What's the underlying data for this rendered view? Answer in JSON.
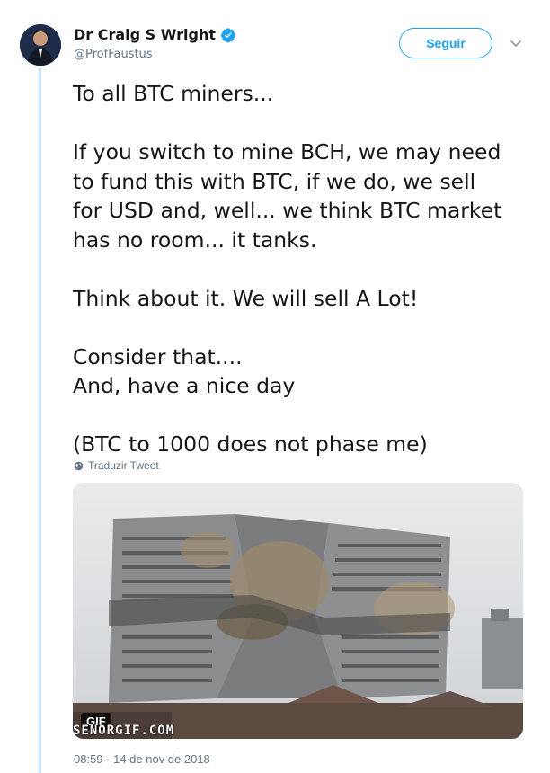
{
  "author": {
    "name": "Dr Craig S Wright",
    "handle": "@ProfFaustus",
    "verified": true
  },
  "follow_button": {
    "label": "Seguir"
  },
  "tweet": {
    "paragraphs": [
      [
        "To all BTC miners..."
      ],
      [
        "If you switch to mine BCH, we may need",
        "to fund this with BTC, if we do, we sell",
        "for USD and, well... we think BTC market",
        "has no room... it tanks."
      ],
      [
        "Think about it. We will sell A Lot!"
      ],
      [
        "Consider that....",
        "And, have a nice day"
      ],
      [
        "(BTC to 1000 does not phase me)"
      ]
    ]
  },
  "translate_link": {
    "label": "Traduzir Tweet",
    "icon": "globe-icon"
  },
  "media": {
    "badge": "GIF",
    "watermark": "SENORGIF.COM"
  },
  "timestamp": "08:59 - 14 de nov de 2018",
  "colors": {
    "accent": "#1da1f2",
    "thread_line": "#bfe0f6",
    "secondary_text": "#657786"
  }
}
